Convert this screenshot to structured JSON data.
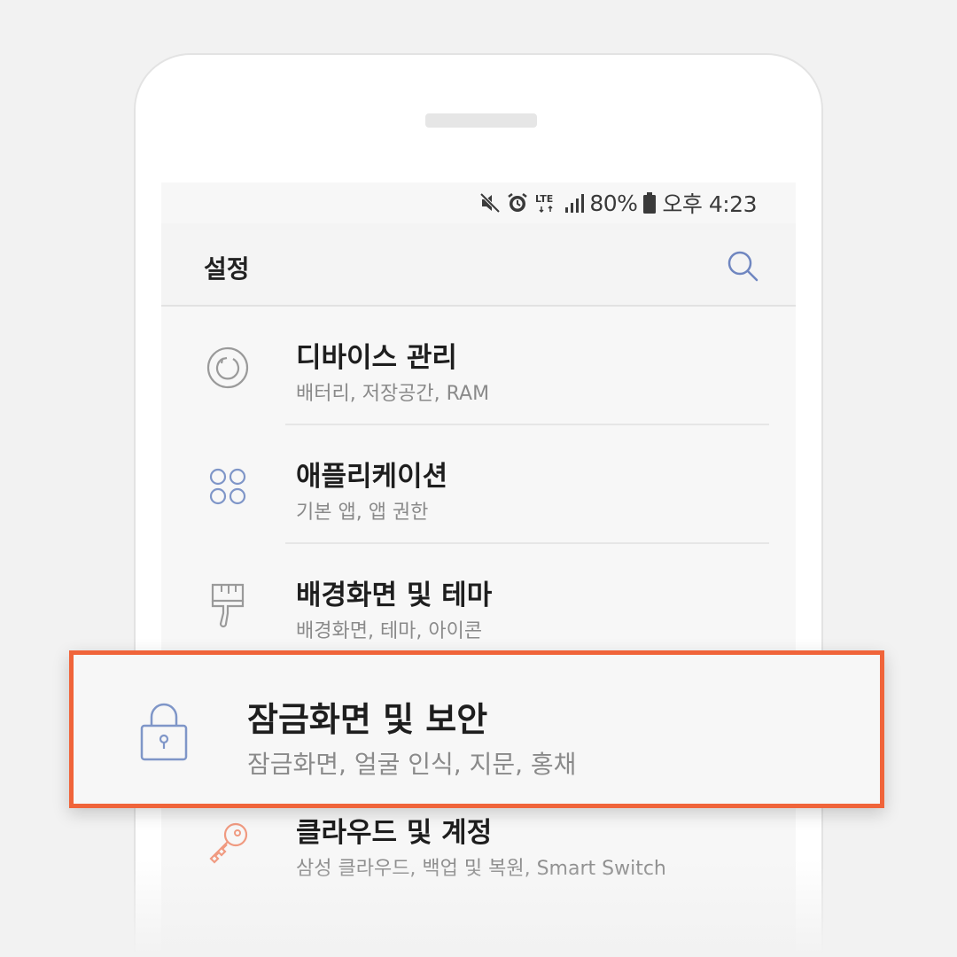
{
  "status_bar": {
    "battery": "80%",
    "time": "오후 4:23",
    "network": "LTE",
    "icons": [
      "mute-icon",
      "alarm-icon",
      "lte-icon",
      "signal-icon",
      "battery-icon"
    ]
  },
  "app_bar": {
    "title": "설정",
    "search_icon": "search-icon"
  },
  "settings_items": [
    {
      "title": "디바이스 관리",
      "subtitle": "배터리, 저장공간, RAM",
      "icon": "device-care-icon"
    },
    {
      "title": "애플리케이션",
      "subtitle": "기본 앱, 앱 권한",
      "icon": "apps-icon"
    },
    {
      "title": "배경화면 및 테마",
      "subtitle": "배경화면, 테마, 아이콘",
      "icon": "brush-icon"
    },
    {
      "title": "잠금화면 및 보안",
      "subtitle": "잠금화면, 얼굴 인식, 지문, 홍채",
      "icon": "lock-icon",
      "highlighted": true
    },
    {
      "title": "클라우드 및 계정",
      "subtitle": "삼성 클라우드, 백업 및 복원, Smart Switch",
      "icon": "key-icon"
    }
  ],
  "colors": {
    "highlight_border": "#f0643a",
    "icon_blue": "#7f96c8",
    "icon_gray": "#9a9a9a",
    "icon_orange": "#f09a80"
  }
}
